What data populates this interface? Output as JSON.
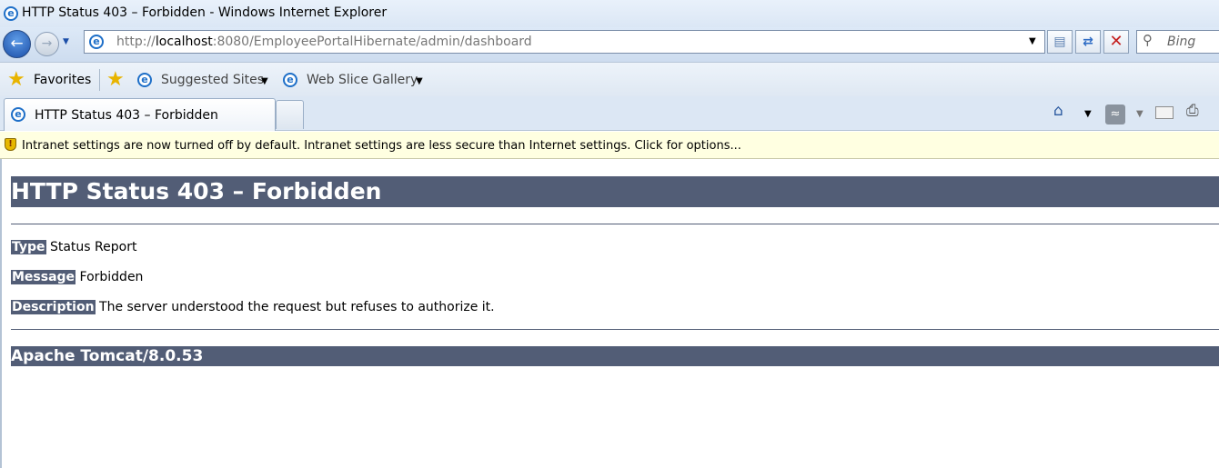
{
  "window": {
    "title": "HTTP Status 403 – Forbidden - Windows Internet Explorer"
  },
  "address_bar": {
    "url_prefix": "http://",
    "url_host": "localhost",
    "url_rest": ":8080/EmployeePortalHibernate/admin/dashboard",
    "search_placeholder": "Bing"
  },
  "favorites_bar": {
    "favorites_label": "Favorites",
    "items": [
      "Suggested Sites",
      "Web Slice Gallery"
    ]
  },
  "tabs": {
    "active_label": "HTTP Status 403 – Forbidden"
  },
  "info_bar": {
    "message": "Intranet settings are now turned off by default. Intranet settings are less secure than Internet settings. Click for options..."
  },
  "page": {
    "heading": "HTTP Status 403 – Forbidden",
    "type_label": "Type",
    "type_value": " Status Report",
    "message_label": "Message",
    "message_value": " Forbidden",
    "description_label": "Description",
    "description_value": " The server understood the request but refuses to authorize it.",
    "footer": "Apache Tomcat/8.0.53"
  },
  "colors": {
    "tomcat_banner": "#525d76",
    "info_bar_bg": "#ffffe1"
  }
}
